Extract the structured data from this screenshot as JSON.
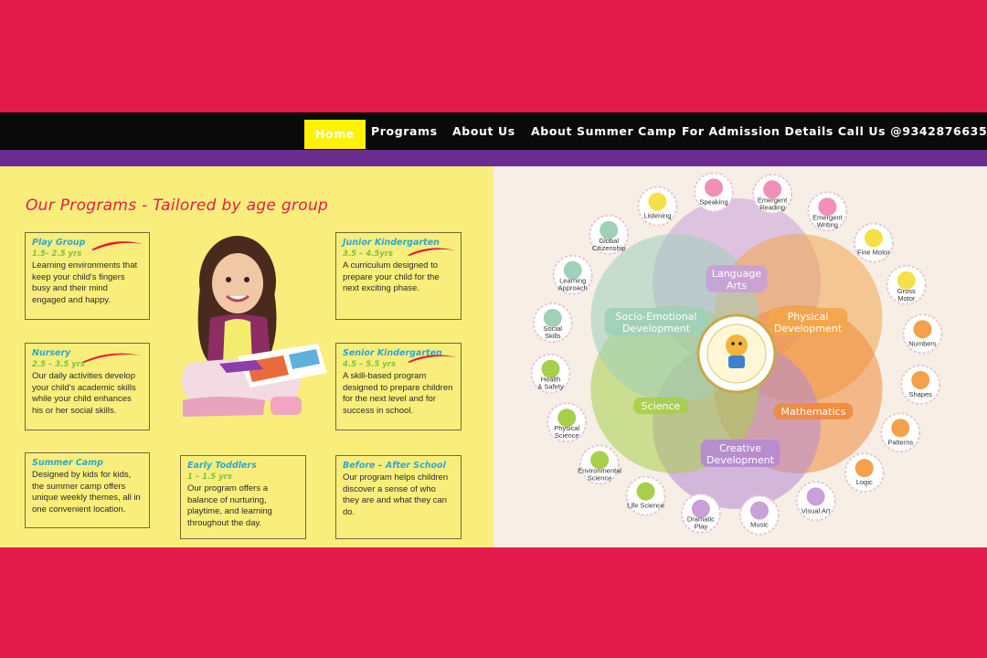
{
  "nav": {
    "home": "Home",
    "programs": "Programs",
    "about": "About Us",
    "summer": "About Summer Camp",
    "admission": "For Admission Details Call Us @9342876635"
  },
  "programs_title": "Our Programs - Tailored by age group",
  "cards": {
    "playgroup": {
      "title": "Play  Group",
      "age": "1.5- 2.5 yrs",
      "text": "Learning environments that keep your child's fingers busy and their mind engaged and happy."
    },
    "junior": {
      "title": "Junior Kindergarten",
      "age": "3.5 – 4.5yrs",
      "text": "A curriculum designed to prepare your child for the next exciting phase."
    },
    "nursery": {
      "title": "Nursery",
      "age": "2.5 – 3.5 yrs",
      "text": "Our daily activities develop your child's academic skills while your child enhances his or her social skills."
    },
    "senior": {
      "title": "Senior Kindergarten",
      "age": "4.5 – 5.5 yrs",
      "text": "A skill-based program designed to prepare children for the next level and for success in school."
    },
    "summer": {
      "title": "Summer Camp",
      "text": "Designed by kids for kids, the summer camp offers unique weekly themes, all in one convenient location."
    },
    "toddlers": {
      "title": "Early Toddlers",
      "age": "1 – 1.5 yrs",
      "text": "Our program offers a balance of nurturing, playtime, and learning throughout the day."
    },
    "before": {
      "title": "Before – After School",
      "text": "Our program helps children discover a sense of who they are and what they can do."
    }
  },
  "wheel": {
    "petals": [
      {
        "label": "Language",
        "label2": "Arts",
        "color": "#c9a0d8"
      },
      {
        "label": "Physical",
        "label2": "Development",
        "color": "#f3a64a"
      },
      {
        "label": "Mathematics",
        "label2": "",
        "color": "#f08a3a"
      },
      {
        "label": "Creative",
        "label2": "Development",
        "color": "#b58ad1"
      },
      {
        "label": "Science",
        "label2": "",
        "color": "#a7cf4a"
      },
      {
        "label": "Socio-Emotional",
        "label2": "Development",
        "color": "#9fd0b9"
      }
    ],
    "badges": [
      {
        "l1": "Listening",
        "l2": "",
        "color": "#f5e04a"
      },
      {
        "l1": "Speaking",
        "l2": "",
        "color": "#f28fb6"
      },
      {
        "l1": "Emergent",
        "l2": "Reading",
        "color": "#f28fb6"
      },
      {
        "l1": "Emergent",
        "l2": "Writing",
        "color": "#f28fb6"
      },
      {
        "l1": "Fine Motor",
        "l2": "",
        "color": "#f5e04a"
      },
      {
        "l1": "Gross",
        "l2": "Motor",
        "color": "#f5e04a"
      },
      {
        "l1": "Numbers",
        "l2": "",
        "color": "#f5a04a"
      },
      {
        "l1": "Shapes",
        "l2": "",
        "color": "#f5a04a"
      },
      {
        "l1": "Patterns",
        "l2": "",
        "color": "#f5a04a"
      },
      {
        "l1": "Logic",
        "l2": "",
        "color": "#f5a04a"
      },
      {
        "l1": "Visual Art",
        "l2": "",
        "color": "#c9a0d8"
      },
      {
        "l1": "Music",
        "l2": "",
        "color": "#c9a0d8"
      },
      {
        "l1": "Dramatic",
        "l2": "Play",
        "color": "#c9a0d8"
      },
      {
        "l1": "Life Science",
        "l2": "",
        "color": "#a7cf4a"
      },
      {
        "l1": "Environmental",
        "l2": "Science",
        "color": "#a7cf4a"
      },
      {
        "l1": "Physical",
        "l2": "Science",
        "color": "#a7cf4a"
      },
      {
        "l1": "Health",
        "l2": "& Safety",
        "color": "#a7cf4a"
      },
      {
        "l1": "Social",
        "l2": "Skills",
        "color": "#9fd0b9"
      },
      {
        "l1": "Learning",
        "l2": "Approach",
        "color": "#9fd0b9"
      },
      {
        "l1": "Global",
        "l2": "Citizenship",
        "color": "#9fd0b9"
      }
    ]
  }
}
